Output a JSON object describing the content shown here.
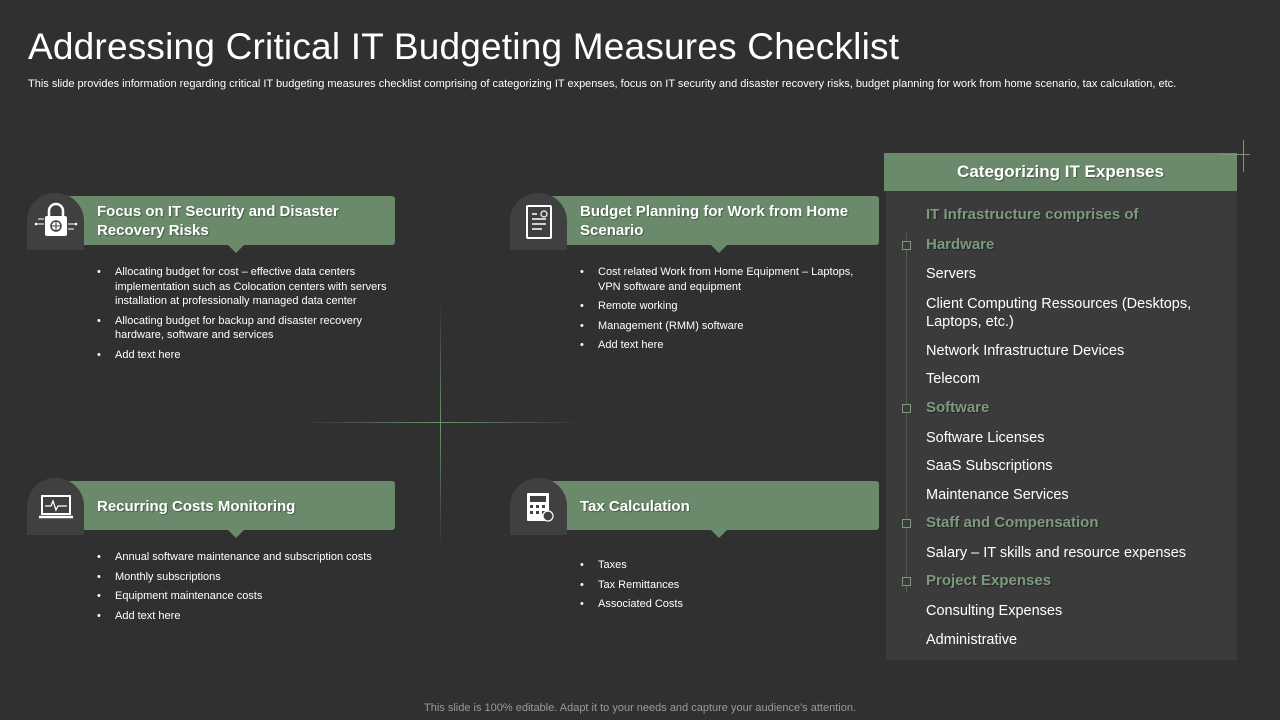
{
  "slide": {
    "title": "Addressing Critical IT Budgeting Measures Checklist",
    "subtitle": "This slide provides information regarding critical IT budgeting measures checklist comprising of categorizing IT  expenses, focus on IT security and disaster recovery risks, budget planning for work from home scenario, tax calculation, etc.",
    "footer": "This slide is 100% editable. Adapt it to your needs and capture your audience's attention."
  },
  "cards": [
    {
      "heading": "Focus on IT Security and Disaster  Recovery Risks",
      "icon": "lock-icon",
      "bullets": [
        "Allocating budget for cost – effective data centers implementation such as Colocation centers with servers installation at professionally managed data center",
        "Allocating budget for backup and disaster recovery hardware, software and services",
        "Add text here"
      ]
    },
    {
      "heading": "Budget Planning for Work from Home Scenario",
      "icon": "document-icon",
      "bullets": [
        "Cost related Work from Home Equipment – Laptops, VPN software and equipment",
        "Remote working",
        "Management (RMM) software",
        "Add text here"
      ]
    },
    {
      "heading": "Recurring Costs  Monitoring",
      "icon": "laptop-monitor-icon",
      "bullets": [
        "Annual software maintenance and subscription costs",
        "Monthly subscriptions",
        "Equipment maintenance costs",
        "Add text here"
      ]
    },
    {
      "heading": "Tax Calculation",
      "icon": "calculator-icon",
      "bullets": [
        "Taxes",
        "Tax Remittances",
        "Associated Costs"
      ]
    }
  ],
  "panel": {
    "title": "Categorizing IT Expenses",
    "intro": "IT Infrastructure comprises of",
    "categories": [
      {
        "name": "Hardware",
        "items": [
          "Servers",
          "Client Computing Ressources (Desktops, Laptops, etc.)",
          "Network Infrastructure Devices",
          "Telecom"
        ]
      },
      {
        "name": "Software",
        "items": [
          "Software Licenses",
          "SaaS Subscriptions",
          "Maintenance  Services"
        ]
      },
      {
        "name": "Staff and Compensation",
        "items": [
          "Salary – IT skills and resource expenses"
        ]
      },
      {
        "name": "Project Expenses",
        "items": [
          "Consulting Expenses",
          "Administrative"
        ]
      }
    ]
  },
  "colors": {
    "background": "#303030",
    "accent_green": "#6b8a6b",
    "category_text": "#7e9a7e",
    "panel_bg": "#3b3b3b"
  }
}
